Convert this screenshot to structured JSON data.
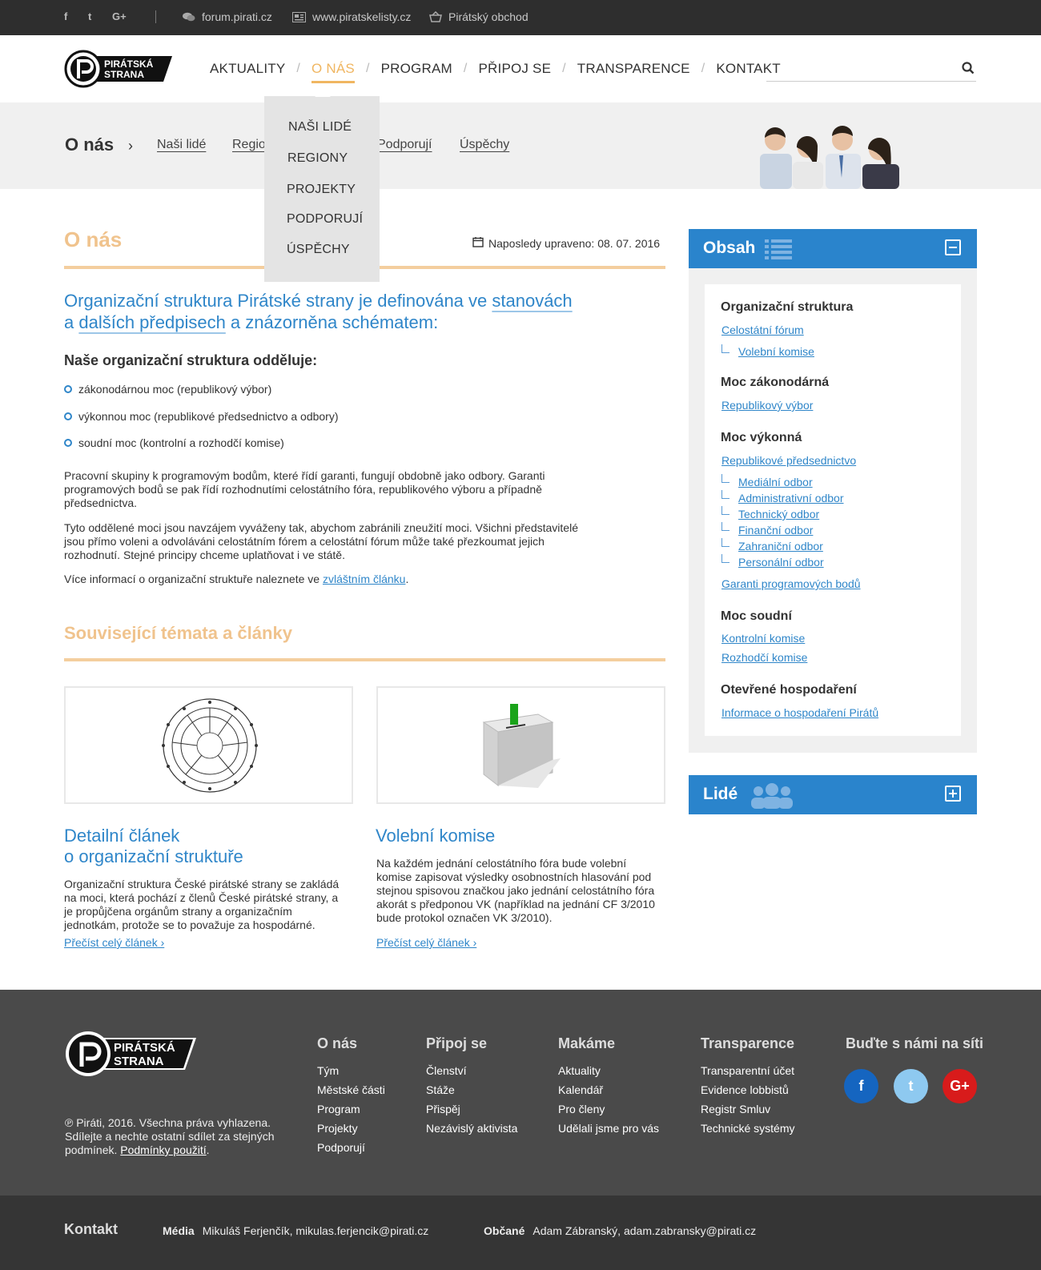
{
  "topbar": {
    "social": [
      "f",
      "t",
      "G+"
    ],
    "links": [
      {
        "label": "forum.pirati.cz",
        "icon": "chat-icon"
      },
      {
        "label": "www.piratskelisty.cz",
        "icon": "newspaper-icon"
      },
      {
        "label": "Pirátský obchod",
        "icon": "basket-icon"
      }
    ]
  },
  "logo": {
    "line1": "PIRÁTSKÁ",
    "line2": "STRANA"
  },
  "nav": {
    "items": [
      "AKTUALITY",
      "O NÁS",
      "PROGRAM",
      "PŘIPOJ SE",
      "TRANSPARENCE",
      "KONTAKT"
    ],
    "active": "O NÁS"
  },
  "search": {
    "placeholder": ""
  },
  "dropdown": {
    "items": [
      "NAŠI LIDÉ",
      "REGIONY",
      "PROJEKTY",
      "PODPORUJÍ",
      "ÚSPĚCHY"
    ]
  },
  "subbar": {
    "title": "O nás",
    "links": [
      "Naši lidé",
      "Regio",
      "Podporují",
      "Úspěchy"
    ]
  },
  "main": {
    "title": "O nás",
    "updated": "Naposledy upraveno: 08. 07. 2016",
    "lead_1": "Organizační struktura Pirátské strany je definována ve ",
    "lead_link_1": "stanovách",
    "lead_2": "a ",
    "lead_link_2": "dalších předpisech",
    "lead_3": " a znázorněna schématem:",
    "subhead": "Naše organizační struktura odděluje:",
    "bullets": [
      "zákonodárnou moc (republikový výbor)",
      "výkonnou moc (republikové předsednictvo a odbory)",
      "soudní moc (kontrolní a rozhodčí komise)"
    ],
    "para1": "Pracovní skupiny k programovým bodům, které řídí garanti, fungují obdobně jako odbory. Garanti programových bodů se pak řídí rozhodnutími celostátního fóra, republikového výboru a případně předsednictva.",
    "para2": "Tyto oddělené moci jsou navzájem vyváženy tak, abychom zabránili zneužití moci. Všichni představitelé jsou přímo voleni a odvoláváni celostátním fórem a celostátní fórum může také přezkoumat jejich rozhodnutí. Stejné principy chceme uplatňovat i ve státě.",
    "para3_pre": "Více informací o organizační struktuře naleznete ve ",
    "para3_link": "zvláštním článku",
    "para3_post": ".",
    "related_title": "Související témata a články"
  },
  "cards": [
    {
      "title_1": "Detailní článek",
      "title_2": "o organizační struktuře",
      "text": "Organizační struktura České pirátské strany se zakládá na moci, která pochází z členů České pirátské strany, a je propůjčena orgánům strany a organizačním jednotkám, protože se to považuje za hospodárné.",
      "more": "Přečíst celý článek ›"
    },
    {
      "title_1": "Volební komise",
      "title_2": "",
      "text": "Na každém jednání celostátního fóra bude volební komise zapisovat výsledky osobnostních hlasování pod stejnou spisovou značkou jako jednání celostátního fóra akorát s předponou VK (například na jednání CF 3/2010 bude protokol označen VK 3/2010).",
      "more": "Přečíst celý článek ›"
    }
  ],
  "sidebar": {
    "obsah_title": "Obsah",
    "lide_title": "Lidé",
    "sections": [
      {
        "head": "Organizační struktura",
        "links": [
          "Celostátní fórum"
        ],
        "sub": [
          "Volební komise"
        ],
        "after": []
      },
      {
        "head": "Moc zákonodárná",
        "links": [
          "Republikový výbor"
        ],
        "sub": [],
        "after": []
      },
      {
        "head": "Moc výkonná",
        "links": [
          "Republikové předsednictvo"
        ],
        "sub": [
          "Mediální odbor",
          "Administrativní odbor",
          "Technický odbor",
          "Finanční odbor",
          "Zahraniční odbor",
          "Personální odbor"
        ],
        "after": [
          "Garanti programových bodů"
        ]
      },
      {
        "head": "Moc soudní",
        "links": [
          "Kontrolní komise",
          "Rozhodčí komise"
        ],
        "sub": [],
        "after": []
      },
      {
        "head": "Otevřené hospodaření",
        "links": [
          "Informace o hospodaření Pirátů"
        ],
        "sub": [],
        "after": []
      }
    ]
  },
  "footer": {
    "copy": "℗ Piráti, 2016. Všechna práva vyhlazena. Sdílejte a nechte ostatní sdílet za stejných podmínek. ",
    "terms": "Podmínky použití",
    "columns": [
      {
        "head": "O nás",
        "items": [
          "Tým",
          "Městské části",
          "Program",
          "Projekty",
          "Podporují"
        ]
      },
      {
        "head": "Připoj se",
        "items": [
          "Členství",
          "Stáže",
          "Přispěj",
          "Nezávislý aktivista"
        ]
      },
      {
        "head": "Makáme",
        "items": [
          "Aktuality",
          "Kalendář",
          "Pro členy",
          "Udělali jsme pro vás"
        ]
      },
      {
        "head": "Transparence",
        "items": [
          "Transparentní účet",
          "Evidence lobbistů",
          "Registr Smluv",
          "Technické systémy"
        ]
      }
    ],
    "social_head": "Buďte s námi na síti",
    "social": [
      {
        "label": "f",
        "color": "#1565c0"
      },
      {
        "label": "t",
        "color": "#8ec9f0"
      },
      {
        "label": "G+",
        "color": "#d81b1b"
      }
    ]
  },
  "bottom": {
    "title": "Kontakt",
    "media_label": "Média",
    "media": "Mikuláš Ferjenčík, mikulas.ferjencik@pirati.cz",
    "obcane_label": "Občané",
    "obcane": "Adam Zábranský, adam.zabransky@pirati.cz"
  },
  "colors": {
    "accent": "#f0b661",
    "link": "#2f86c9",
    "panel": "#2a84cc"
  }
}
